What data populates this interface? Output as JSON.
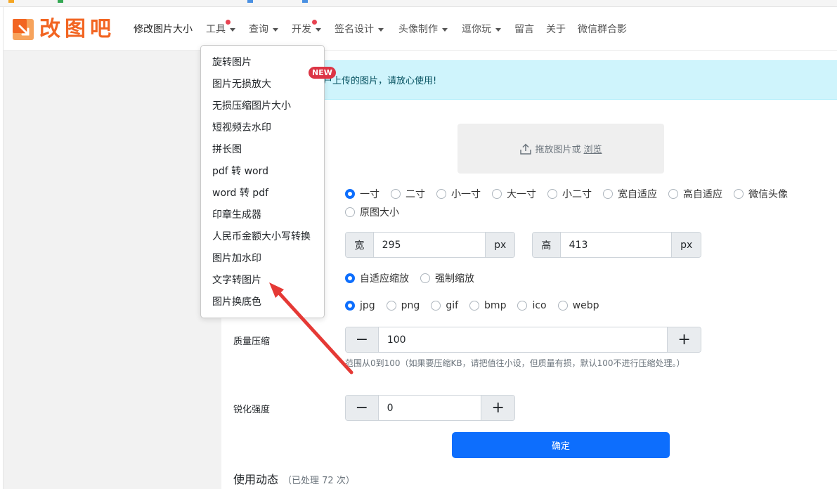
{
  "logo": {
    "text": "改图吧"
  },
  "nav": {
    "items": [
      {
        "label": "修改图片大小",
        "has_caret": false,
        "has_dot": false
      },
      {
        "label": "工具",
        "has_caret": true,
        "has_dot": true
      },
      {
        "label": "查询",
        "has_caret": true,
        "has_dot": false
      },
      {
        "label": "开发",
        "has_caret": true,
        "has_dot": true
      },
      {
        "label": "签名设计",
        "has_caret": true,
        "has_dot": false
      },
      {
        "label": "头像制作",
        "has_caret": true,
        "has_dot": false
      },
      {
        "label": "逗你玩",
        "has_caret": true,
        "has_dot": false
      },
      {
        "label": "留言",
        "has_caret": false,
        "has_dot": false
      },
      {
        "label": "关于",
        "has_caret": false,
        "has_dot": false
      },
      {
        "label": "微信群合影",
        "has_caret": false,
        "has_dot": false
      }
    ]
  },
  "dropdown": {
    "items": [
      "旋转图片",
      "图片无损放大",
      "无损压缩图片大小",
      "短视频去水印",
      "拼长图",
      "pdf 转 word",
      "word 转 pdf",
      "印章生成器",
      "人民币金额大小写转换",
      "图片加水印",
      "文字转图片",
      "图片换底色"
    ],
    "badge": "NEW"
  },
  "alert": {
    "text": "户上传的图片，请放心使用!"
  },
  "upload": {
    "label": "拖放图片或",
    "link": "浏览"
  },
  "size_options": {
    "selected": "一寸",
    "row1": [
      "一寸",
      "二寸",
      "小一寸",
      "大一寸",
      "小二寸",
      "宽自适应",
      "高自适应",
      "微信头像"
    ],
    "row2": [
      "原图大小"
    ]
  },
  "dimensions": {
    "width_label": "宽",
    "width_value": "295",
    "width_unit": "px",
    "height_label": "高",
    "height_value": "413",
    "height_unit": "px"
  },
  "scale_options": {
    "selected": "自适应缩放",
    "items": [
      "自适应缩放",
      "强制缩放"
    ]
  },
  "format_options": {
    "selected": "jpg",
    "items": [
      "jpg",
      "png",
      "gif",
      "bmp",
      "ico",
      "webp"
    ]
  },
  "quality": {
    "label": "质量压缩",
    "value": "100",
    "minus": "−",
    "plus": "+",
    "help": "范围从0到100（如果要压缩KB，请把值往小设，但质量有损，默认100不进行压缩处理。）"
  },
  "sharpen": {
    "label": "锐化强度",
    "value": "0",
    "minus": "−",
    "plus": "+"
  },
  "confirm_button": "确定",
  "usage": {
    "title": "使用动态",
    "count": "（已处理 72 次）"
  },
  "colors": {
    "brand": "#f26522",
    "primary": "#0d6efd",
    "alert_bg": "#cff4fc",
    "badge": "#dc3545",
    "arrow": "#e53935"
  }
}
